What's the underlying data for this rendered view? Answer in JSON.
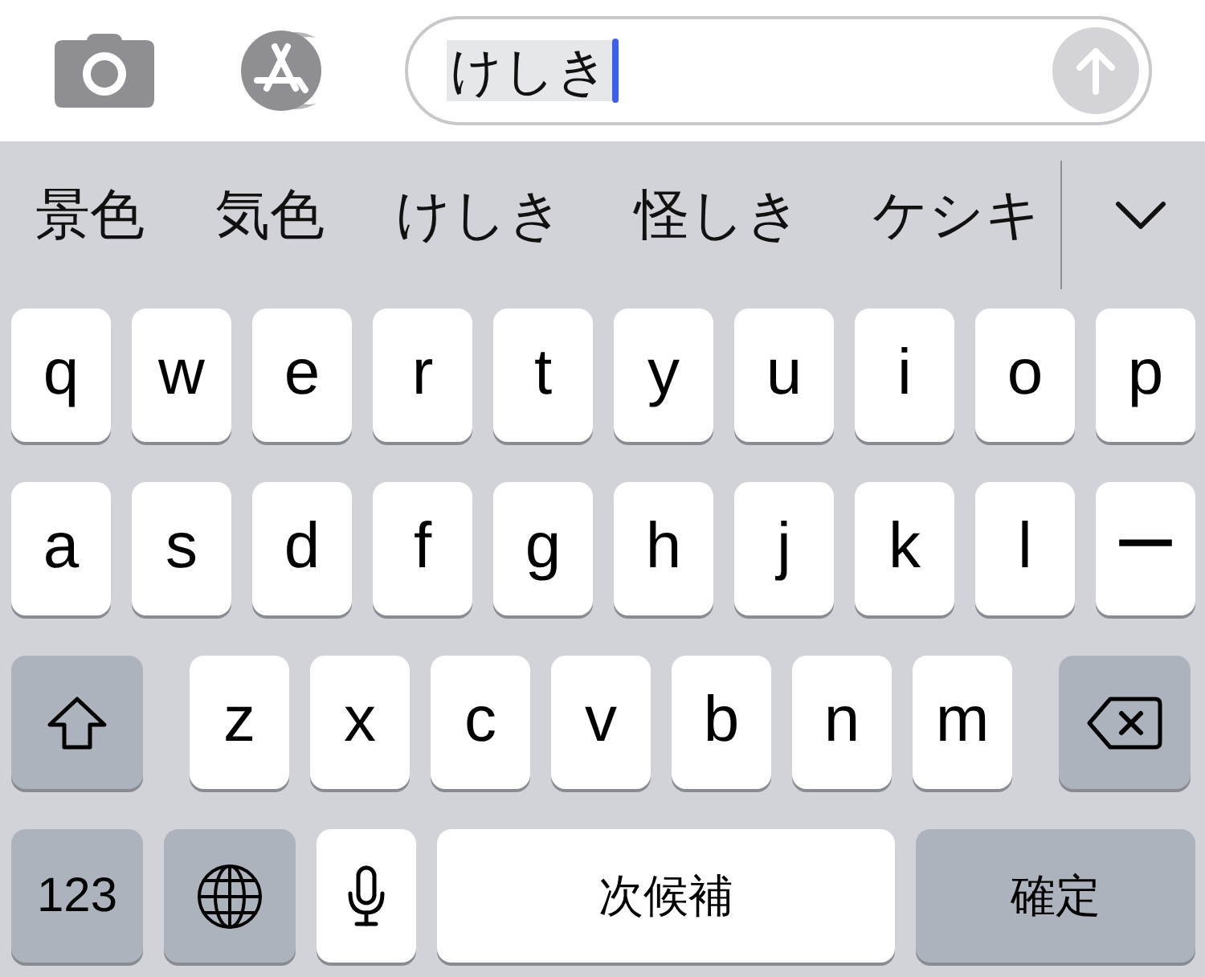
{
  "top_bar": {
    "message_field": {
      "value": "けしき",
      "marked": true
    },
    "send_enabled": false
  },
  "candidates": [
    {
      "text": "景色"
    },
    {
      "text": "気色"
    },
    {
      "text": "けしき"
    },
    {
      "text": "怪しき"
    },
    {
      "text": "ケシキ"
    }
  ],
  "keyboard": {
    "rows": [
      {
        "keys": [
          {
            "kind": "letter",
            "label": "q"
          },
          {
            "kind": "letter",
            "label": "w"
          },
          {
            "kind": "letter",
            "label": "e"
          },
          {
            "kind": "letter",
            "label": "r"
          },
          {
            "kind": "letter",
            "label": "t"
          },
          {
            "kind": "letter",
            "label": "y"
          },
          {
            "kind": "letter",
            "label": "u"
          },
          {
            "kind": "letter",
            "label": "i"
          },
          {
            "kind": "letter",
            "label": "o"
          },
          {
            "kind": "letter",
            "label": "p"
          }
        ]
      },
      {
        "keys": [
          {
            "kind": "letter",
            "label": "a"
          },
          {
            "kind": "letter",
            "label": "s"
          },
          {
            "kind": "letter",
            "label": "d"
          },
          {
            "kind": "letter",
            "label": "f"
          },
          {
            "kind": "letter",
            "label": "g"
          },
          {
            "kind": "letter",
            "label": "h"
          },
          {
            "kind": "letter",
            "label": "j"
          },
          {
            "kind": "letter",
            "label": "k"
          },
          {
            "kind": "letter",
            "label": "l"
          },
          {
            "kind": "letter",
            "label": "ー"
          }
        ]
      },
      {
        "keys": [
          {
            "kind": "shift"
          },
          {
            "kind": "letter",
            "label": "z"
          },
          {
            "kind": "letter",
            "label": "x"
          },
          {
            "kind": "letter",
            "label": "c"
          },
          {
            "kind": "letter",
            "label": "v"
          },
          {
            "kind": "letter",
            "label": "b"
          },
          {
            "kind": "letter",
            "label": "n"
          },
          {
            "kind": "letter",
            "label": "m"
          },
          {
            "kind": "delete"
          }
        ]
      },
      {
        "keys": [
          {
            "kind": "numbers",
            "label": "123"
          },
          {
            "kind": "globe"
          },
          {
            "kind": "mic"
          },
          {
            "kind": "space",
            "label": "次候補"
          },
          {
            "kind": "confirm",
            "label": "確定"
          }
        ]
      }
    ]
  }
}
